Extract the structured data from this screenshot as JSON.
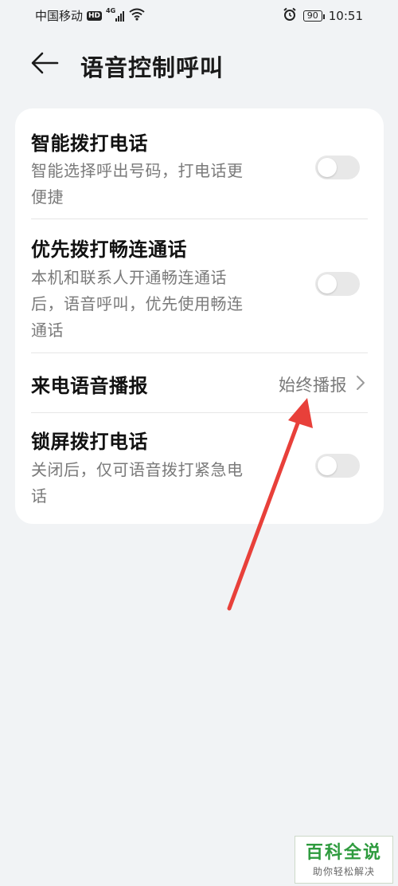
{
  "status_bar": {
    "carrier": "中国移动",
    "hd": "HD",
    "network": "4G",
    "battery": "90",
    "time": "10:51"
  },
  "header": {
    "title": "语音控制呼叫"
  },
  "settings": {
    "smart_dial": {
      "title": "智能拨打电话",
      "desc_line1": "智能选择呼出号码，打电话更",
      "desc_line2": "便捷",
      "enabled": false
    },
    "changlian_first": {
      "title": "优先拨打畅连通话",
      "desc_line1": "本机和联系人开通畅连通话",
      "desc_line2": "后，语音呼叫，优先使用畅连",
      "desc_line3": "通话",
      "enabled": false
    },
    "incoming_announce": {
      "title": "来电语音播报",
      "value": "始终播报"
    },
    "lockscreen_dial": {
      "title": "锁屏拨打电话",
      "desc_line1": "关闭后，仅可语音拨打紧急电",
      "desc_line2": "话",
      "enabled": false
    }
  },
  "annotation": {
    "arrow_color": "#e8403a"
  },
  "watermark": {
    "title": "百科全说",
    "subtitle": "助你轻松解决"
  },
  "colors": {
    "background": "#f1f3f5",
    "card": "#ffffff",
    "toggle_off": "#e8e8e8",
    "secondary_text": "#7a7a7a",
    "watermark_green": "#2e9b3e"
  }
}
